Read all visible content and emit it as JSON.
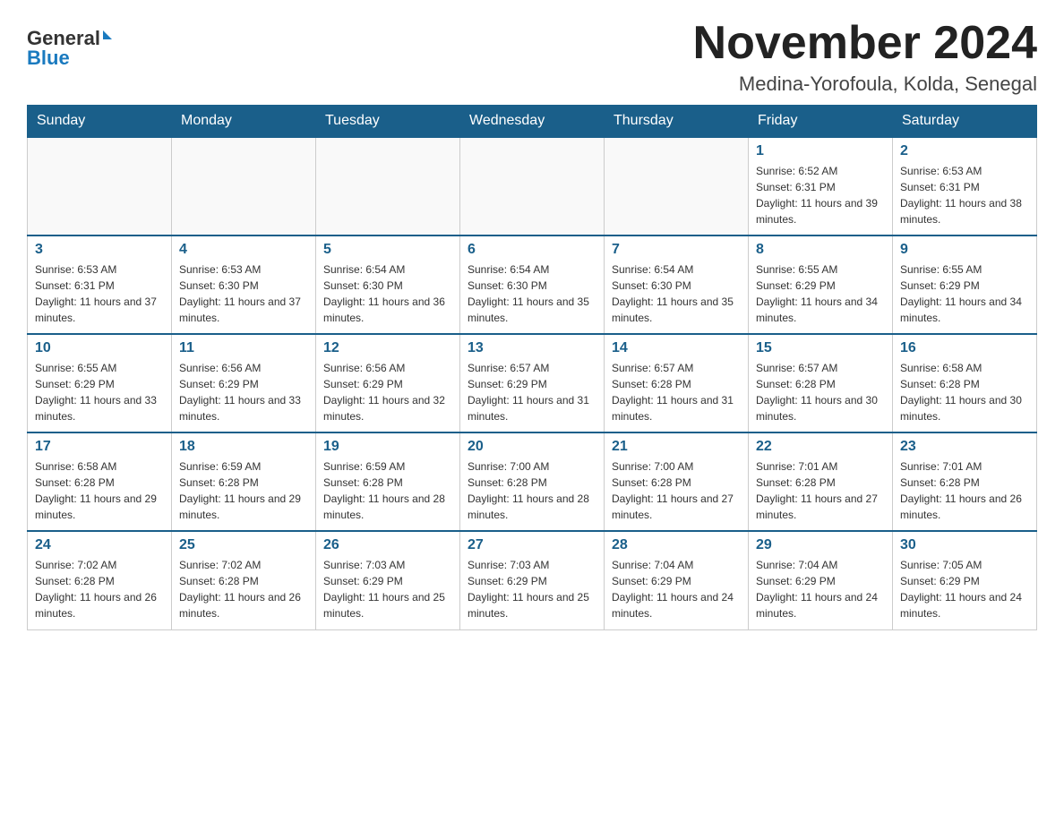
{
  "logo": {
    "general": "General",
    "blue": "Blue",
    "arrow": "▶"
  },
  "title": "November 2024",
  "location": "Medina-Yorofoula, Kolda, Senegal",
  "days_of_week": [
    "Sunday",
    "Monday",
    "Tuesday",
    "Wednesday",
    "Thursday",
    "Friday",
    "Saturday"
  ],
  "weeks": [
    [
      {
        "day": "",
        "info": ""
      },
      {
        "day": "",
        "info": ""
      },
      {
        "day": "",
        "info": ""
      },
      {
        "day": "",
        "info": ""
      },
      {
        "day": "",
        "info": ""
      },
      {
        "day": "1",
        "info": "Sunrise: 6:52 AM\nSunset: 6:31 PM\nDaylight: 11 hours and 39 minutes."
      },
      {
        "day": "2",
        "info": "Sunrise: 6:53 AM\nSunset: 6:31 PM\nDaylight: 11 hours and 38 minutes."
      }
    ],
    [
      {
        "day": "3",
        "info": "Sunrise: 6:53 AM\nSunset: 6:31 PM\nDaylight: 11 hours and 37 minutes."
      },
      {
        "day": "4",
        "info": "Sunrise: 6:53 AM\nSunset: 6:30 PM\nDaylight: 11 hours and 37 minutes."
      },
      {
        "day": "5",
        "info": "Sunrise: 6:54 AM\nSunset: 6:30 PM\nDaylight: 11 hours and 36 minutes."
      },
      {
        "day": "6",
        "info": "Sunrise: 6:54 AM\nSunset: 6:30 PM\nDaylight: 11 hours and 35 minutes."
      },
      {
        "day": "7",
        "info": "Sunrise: 6:54 AM\nSunset: 6:30 PM\nDaylight: 11 hours and 35 minutes."
      },
      {
        "day": "8",
        "info": "Sunrise: 6:55 AM\nSunset: 6:29 PM\nDaylight: 11 hours and 34 minutes."
      },
      {
        "day": "9",
        "info": "Sunrise: 6:55 AM\nSunset: 6:29 PM\nDaylight: 11 hours and 34 minutes."
      }
    ],
    [
      {
        "day": "10",
        "info": "Sunrise: 6:55 AM\nSunset: 6:29 PM\nDaylight: 11 hours and 33 minutes."
      },
      {
        "day": "11",
        "info": "Sunrise: 6:56 AM\nSunset: 6:29 PM\nDaylight: 11 hours and 33 minutes."
      },
      {
        "day": "12",
        "info": "Sunrise: 6:56 AM\nSunset: 6:29 PM\nDaylight: 11 hours and 32 minutes."
      },
      {
        "day": "13",
        "info": "Sunrise: 6:57 AM\nSunset: 6:29 PM\nDaylight: 11 hours and 31 minutes."
      },
      {
        "day": "14",
        "info": "Sunrise: 6:57 AM\nSunset: 6:28 PM\nDaylight: 11 hours and 31 minutes."
      },
      {
        "day": "15",
        "info": "Sunrise: 6:57 AM\nSunset: 6:28 PM\nDaylight: 11 hours and 30 minutes."
      },
      {
        "day": "16",
        "info": "Sunrise: 6:58 AM\nSunset: 6:28 PM\nDaylight: 11 hours and 30 minutes."
      }
    ],
    [
      {
        "day": "17",
        "info": "Sunrise: 6:58 AM\nSunset: 6:28 PM\nDaylight: 11 hours and 29 minutes."
      },
      {
        "day": "18",
        "info": "Sunrise: 6:59 AM\nSunset: 6:28 PM\nDaylight: 11 hours and 29 minutes."
      },
      {
        "day": "19",
        "info": "Sunrise: 6:59 AM\nSunset: 6:28 PM\nDaylight: 11 hours and 28 minutes."
      },
      {
        "day": "20",
        "info": "Sunrise: 7:00 AM\nSunset: 6:28 PM\nDaylight: 11 hours and 28 minutes."
      },
      {
        "day": "21",
        "info": "Sunrise: 7:00 AM\nSunset: 6:28 PM\nDaylight: 11 hours and 27 minutes."
      },
      {
        "day": "22",
        "info": "Sunrise: 7:01 AM\nSunset: 6:28 PM\nDaylight: 11 hours and 27 minutes."
      },
      {
        "day": "23",
        "info": "Sunrise: 7:01 AM\nSunset: 6:28 PM\nDaylight: 11 hours and 26 minutes."
      }
    ],
    [
      {
        "day": "24",
        "info": "Sunrise: 7:02 AM\nSunset: 6:28 PM\nDaylight: 11 hours and 26 minutes."
      },
      {
        "day": "25",
        "info": "Sunrise: 7:02 AM\nSunset: 6:28 PM\nDaylight: 11 hours and 26 minutes."
      },
      {
        "day": "26",
        "info": "Sunrise: 7:03 AM\nSunset: 6:29 PM\nDaylight: 11 hours and 25 minutes."
      },
      {
        "day": "27",
        "info": "Sunrise: 7:03 AM\nSunset: 6:29 PM\nDaylight: 11 hours and 25 minutes."
      },
      {
        "day": "28",
        "info": "Sunrise: 7:04 AM\nSunset: 6:29 PM\nDaylight: 11 hours and 24 minutes."
      },
      {
        "day": "29",
        "info": "Sunrise: 7:04 AM\nSunset: 6:29 PM\nDaylight: 11 hours and 24 minutes."
      },
      {
        "day": "30",
        "info": "Sunrise: 7:05 AM\nSunset: 6:29 PM\nDaylight: 11 hours and 24 minutes."
      }
    ]
  ]
}
